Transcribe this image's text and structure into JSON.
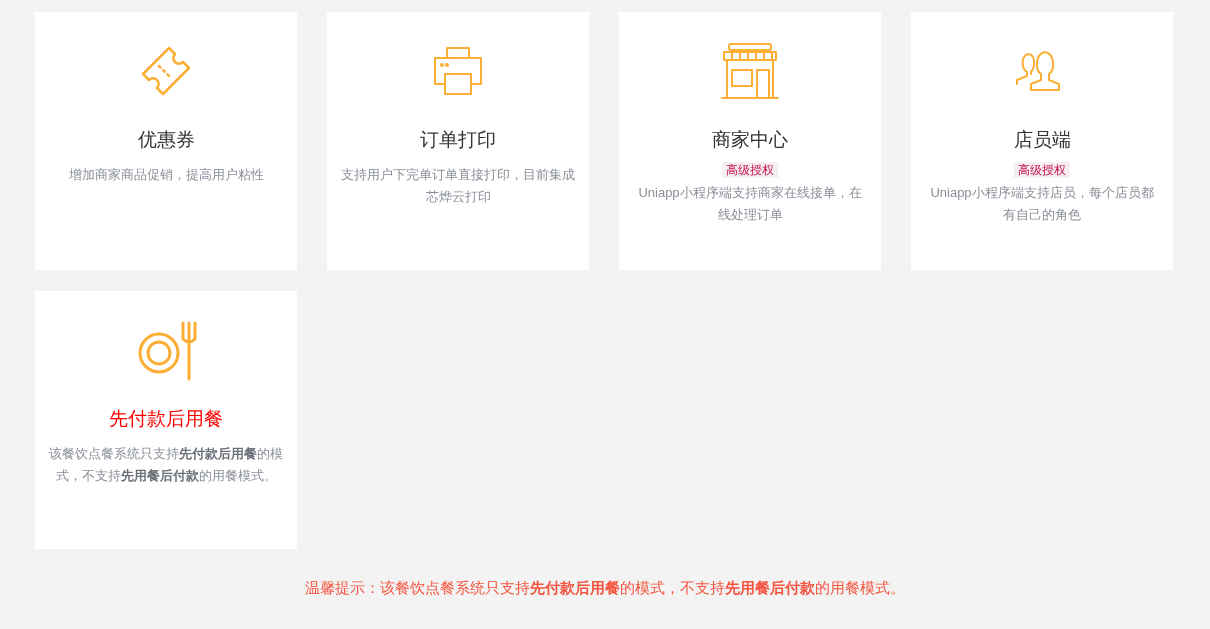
{
  "cards": [
    {
      "kind": "ticket",
      "title": "优惠券",
      "highlight": false,
      "description": "增加商家商品促销，提高用户粘性"
    },
    {
      "kind": "printer",
      "title": "订单打印",
      "highlight": false,
      "description": "支持用户下完单订单直接打印，目前集成芯烨云打印"
    },
    {
      "kind": "store",
      "title": "商家中心",
      "highlight": false,
      "badge": "高级授权",
      "description": "Uniapp小程序端支持商家在线接单，在线处理订单"
    },
    {
      "kind": "users",
      "title": "店员端",
      "highlight": false,
      "badge": "高级授权",
      "description": "Uniapp小程序端支持店员，每个店员都有自己的角色"
    },
    {
      "kind": "dining",
      "title": "先付款后用餐",
      "highlight": true,
      "description": "该餐饮点餐系统只支持**先付款后用餐**的模式，不支持**先用餐后付款**的用餐模式。"
    }
  ],
  "notice": "温馨提示：该餐饮点餐系统只支持**先付款后用餐**的模式，不支持**先用餐后付款**的用餐模式。"
}
